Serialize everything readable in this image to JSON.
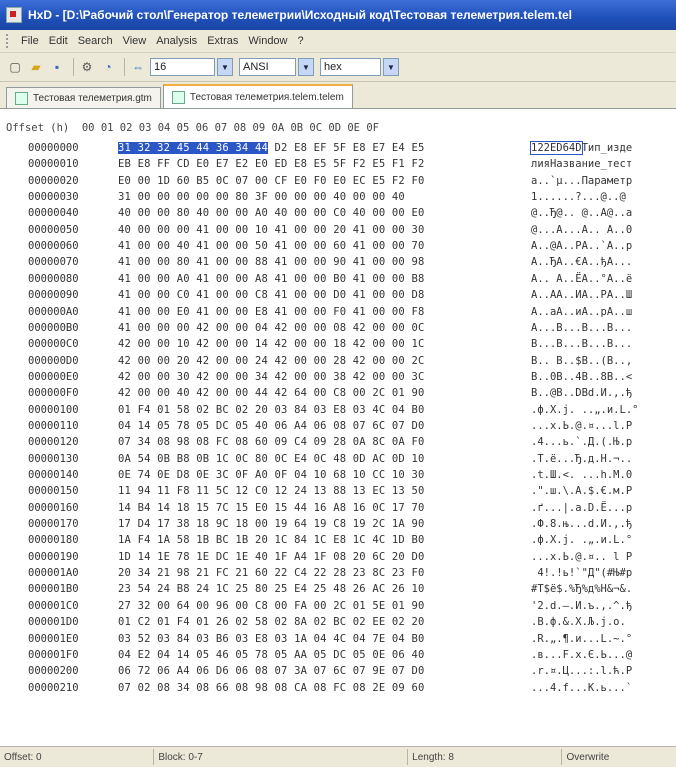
{
  "window": {
    "title": "HxD - [D:\\Рабочий стол\\Генератор телеметрии\\Исходный код\\Тестовая телеметрия.telem.tel"
  },
  "menu": [
    "File",
    "Edit",
    "Search",
    "View",
    "Analysis",
    "Extras",
    "Window",
    "?"
  ],
  "toolbar": {
    "bytes_per_row": "16",
    "charset": "ANSI",
    "offset_base": "hex",
    "icons": [
      "new-file-icon",
      "open-folder-icon",
      "save-icon",
      "properties-icon",
      "refresh-icon",
      "columns-icon"
    ]
  },
  "tabs": [
    {
      "label": "Тестовая телеметрия.gtm"
    },
    {
      "label": "Тестовая телеметрия.telem.telem"
    }
  ],
  "header": "Offset (h)  00 01 02 03 04 05 06 07 08 09 0A 0B 0C 0D 0E 0F",
  "rows": [
    {
      "off": "00000000",
      "hex": "31 32 32 45 44 36 34 44 D2 E8 EF 5F E8 E7 E4 E5",
      "txt": "122ED64DТип_изде"
    },
    {
      "off": "00000010",
      "hex": "EB E8 FF CD E0 E7 E2 E0 ED E8 E5 5F F2 E5 F1 F2",
      "txt": "лияНазвание_тест"
    },
    {
      "off": "00000020",
      "hex": "E0 00 1D 60 B5 0C 07 00 CF E0 F0 E0 EC E5 F2 F0",
      "txt": "а..`µ...Параметр"
    },
    {
      "off": "00000030",
      "hex": "31 00 00 00 00 00 80 3F 00 00 00 40 00 00 40",
      "txt": "1......?...@..@"
    },
    {
      "off": "00000040",
      "hex": "40 00 00 80 40 00 00 A0 40 00 00 C0 40 00 00 E0",
      "txt": "@..Ђ@.. @..А@..а"
    },
    {
      "off": "00000050",
      "hex": "40 00 00 00 41 00 00 10 41 00 00 20 41 00 00 30",
      "txt": "@...A...A.. A..0"
    },
    {
      "off": "00000060",
      "hex": "41 00 00 40 41 00 00 50 41 00 00 60 41 00 00 70",
      "txt": "A..@A..PA..`A..p"
    },
    {
      "off": "00000070",
      "hex": "41 00 00 80 41 00 00 88 41 00 00 90 41 00 00 98",
      "txt": "A..ЂA..€A..ђA..."
    },
    {
      "off": "00000080",
      "hex": "41 00 00 A0 41 00 00 A8 41 00 00 B0 41 00 00 B8",
      "txt": "A.. A..ЁA..°A..ё"
    },
    {
      "off": "00000090",
      "hex": "41 00 00 C0 41 00 00 C8 41 00 00 D0 41 00 00 D8",
      "txt": "A..АA..ИA..РA..Ш"
    },
    {
      "off": "000000A0",
      "hex": "41 00 00 E0 41 00 00 E8 41 00 00 F0 41 00 00 F8",
      "txt": "A..аA..иA..рA..ш"
    },
    {
      "off": "000000B0",
      "hex": "41 00 00 00 42 00 00 04 42 00 00 08 42 00 00 0C",
      "txt": "A...B...B...B..."
    },
    {
      "off": "000000C0",
      "hex": "42 00 00 10 42 00 00 14 42 00 00 18 42 00 00 1C",
      "txt": "B...B...B...B..."
    },
    {
      "off": "000000D0",
      "hex": "42 00 00 20 42 00 00 24 42 00 00 28 42 00 00 2C",
      "txt": "B.. B..$B..(B..,"
    },
    {
      "off": "000000E0",
      "hex": "42 00 00 30 42 00 00 34 42 00 00 38 42 00 00 3C",
      "txt": "B..0B..4B..8B..<"
    },
    {
      "off": "000000F0",
      "hex": "42 00 00 40 42 00 00 44 42 64 00 C8 00 2C 01 90",
      "txt": "B..@B..DBd.И.,.ђ"
    },
    {
      "off": "00000100",
      "hex": "01 F4 01 58 02 BC 02 20 03 84 03 E8 03 4C 04 B0",
      "txt": ".ф.X.ј. ..„.и.L.°"
    },
    {
      "off": "00000110",
      "hex": "04 14 05 78 05 DC 05 40 06 A4 06 08 07 6C 07 D0",
      "txt": "...x.Ь.@.¤...l.Р"
    },
    {
      "off": "00000120",
      "hex": "07 34 08 98 08 FC 08 60 09 C4 09 28 0A 8C 0A F0",
      "txt": ".4...ь.`.Д.(.Њ.р"
    },
    {
      "off": "00000130",
      "hex": "0A 54 0B B8 0B 1C 0C 80 0C E4 0C 48 0D AC 0D 10",
      "txt": ".T.ё...Ђ.д.H.¬.."
    },
    {
      "off": "00000140",
      "hex": "0E 74 0E D8 0E 3C 0F A0 0F 04 10 68 10 CC 10 30",
      "txt": ".t.Ш.<. ...h.М.0"
    },
    {
      "off": "00000150",
      "hex": "11 94 11 F8 11 5C 12 C0 12 24 13 88 13 EC 13 50",
      "txt": ".\".ш.\\.А.$.€.м.P"
    },
    {
      "off": "00000160",
      "hex": "14 B4 14 18 15 7C 15 E0 15 44 16 A8 16 0C 17 70",
      "txt": ".ґ...|.а.D.Ё...p"
    },
    {
      "off": "00000170",
      "hex": "17 D4 17 38 18 9C 18 00 19 64 19 C8 19 2C 1A 90",
      "txt": ".Ф.8.њ...d.И.,.ђ"
    },
    {
      "off": "00000180",
      "hex": "1A F4 1A 58 1B BC 1B 20 1C 84 1C E8 1C 4C 1D B0",
      "txt": ".ф.X.ј. .„.и.L.°"
    },
    {
      "off": "00000190",
      "hex": "1D 14 1E 78 1E DC 1E 40 1F A4 1F 08 20 6C 20 D0",
      "txt": "...x.Ь.@.¤.. l Р"
    },
    {
      "off": "000001A0",
      "hex": "20 34 21 98 21 FC 21 60 22 C4 22 28 23 8C 23 F0",
      "txt": " 4!.!ь!`\"Д\"(#Њ#р"
    },
    {
      "off": "000001B0",
      "hex": "23 54 24 B8 24 1C 25 80 25 E4 25 48 26 AC 26 10",
      "txt": "#T$ё$.%Ђ%д%H&¬&."
    },
    {
      "off": "000001C0",
      "hex": "27 32 00 64 00 96 00 C8 00 FA 00 2C 01 5E 01 90",
      "txt": "'2.d.–.И.ъ.,.^.ђ"
    },
    {
      "off": "000001D0",
      "hex": "01 C2 01 F4 01 26 02 58 02 8A 02 BC 02 EE 02 20",
      "txt": ".В.ф.&.X.Љ.ј.о. "
    },
    {
      "off": "000001E0",
      "hex": "03 52 03 84 03 B6 03 E8 03 1A 04 4C 04 7E 04 B0",
      "txt": ".R.„.¶.и...L.~.°"
    },
    {
      "off": "000001F0",
      "hex": "04 E2 04 14 05 46 05 78 05 AA 05 DC 05 0E 06 40",
      "txt": ".в...F.x.Є.Ь...@"
    },
    {
      "off": "00000200",
      "hex": "06 72 06 A4 06 D6 06 08 07 3A 07 6C 07 9E 07 D0",
      "txt": ".r.¤.Ц...:.l.ћ.Р"
    },
    {
      "off": "00000210",
      "hex": "07 02 08 34 08 66 08 98 08 CA 08 FC 08 2E 09 60",
      "txt": "...4.f...К.ь...`"
    }
  ],
  "selection": {
    "row": 0,
    "hex_selected": "31 32 32 45 44 36 34 44",
    "txt_selected": "122ED64D"
  },
  "status": {
    "offset": "Offset: 0",
    "block": "Block: 0-7",
    "length": "Length: 8",
    "mode": "Overwrite"
  },
  "colors": {
    "titlebar": "#1f4fb8",
    "selection": "#2a56c6",
    "chrome": "#ece9d8"
  }
}
